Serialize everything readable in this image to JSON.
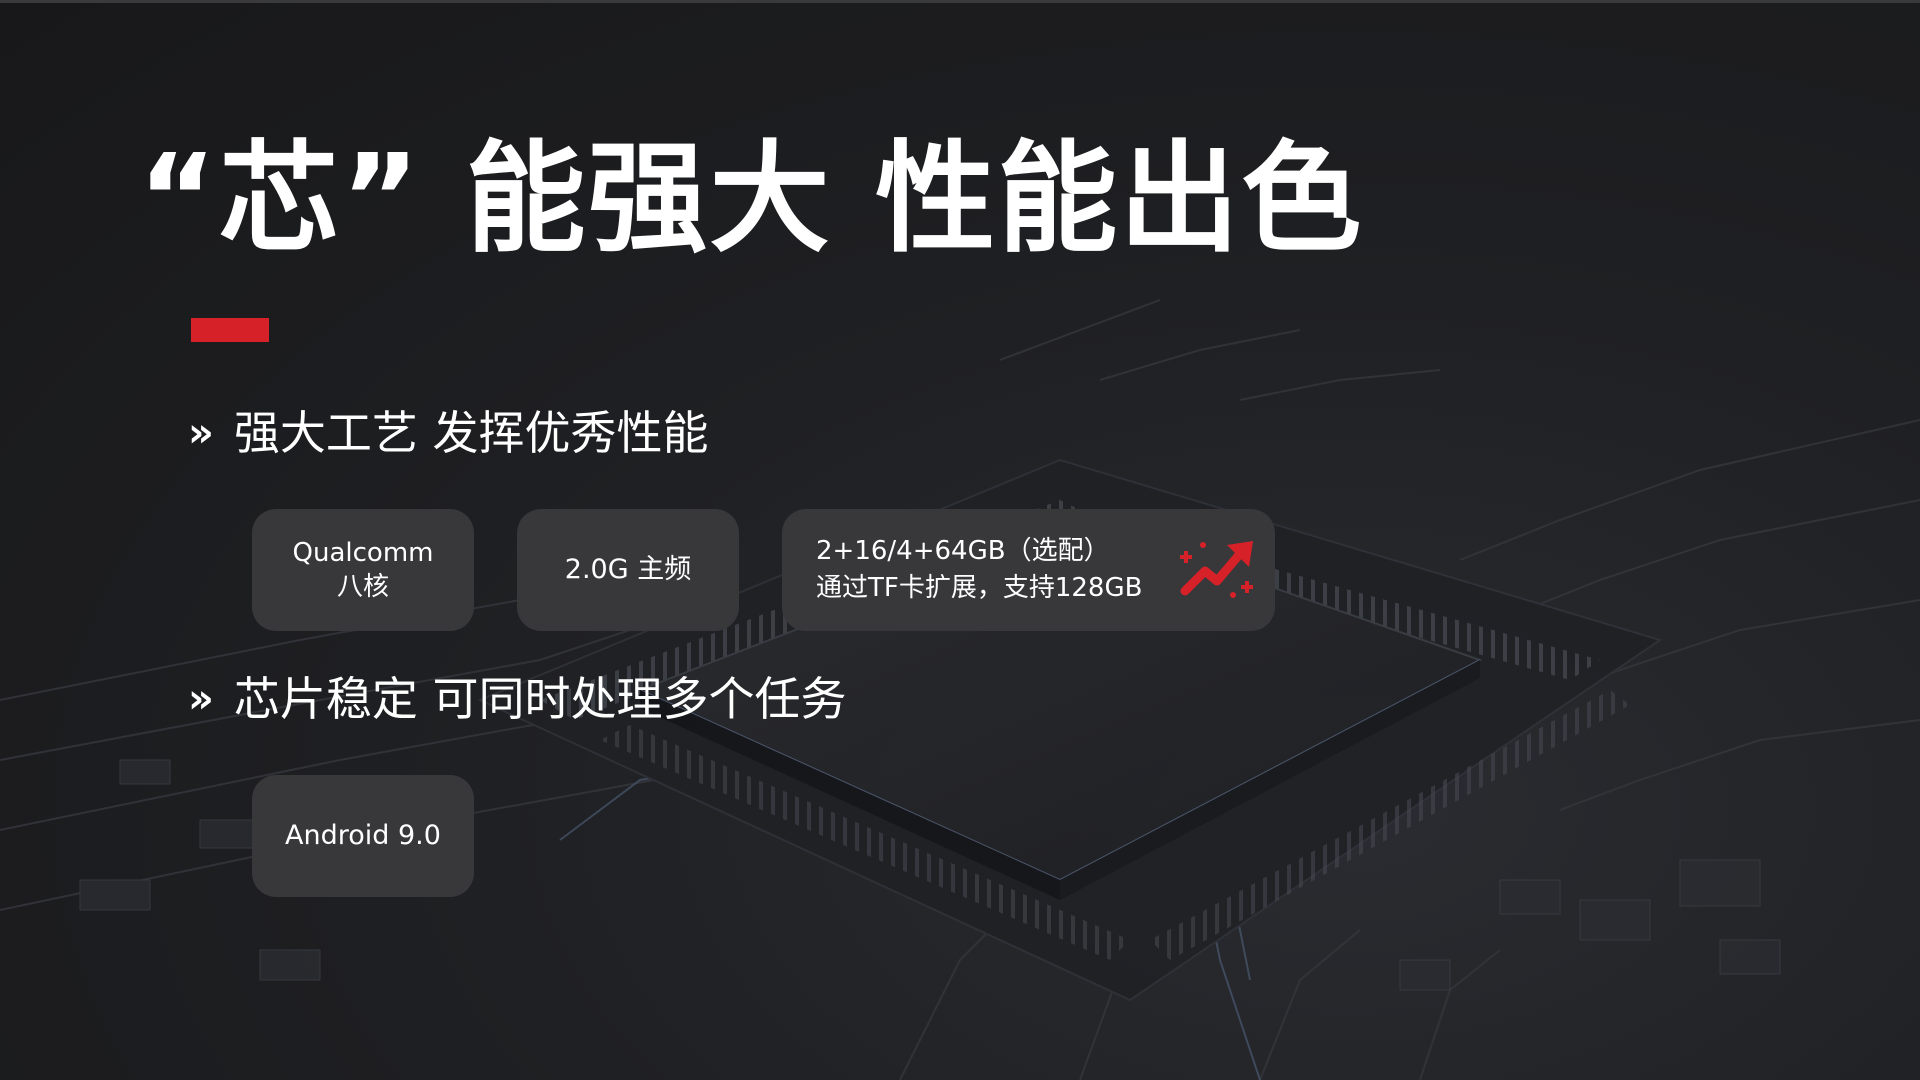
{
  "title": "“芯” 能强大 性能出色",
  "colors": {
    "accent": "#d62128",
    "card": "#38383b",
    "text": "#ffffff",
    "background": "#1b1b1d"
  },
  "sections": [
    {
      "marker": "»",
      "heading": "强大工艺  发挥优秀性能",
      "cards": [
        {
          "line1": "Qualcomm",
          "line2": "八核"
        },
        {
          "text": "2.0G 主频"
        },
        {
          "line1": "2+16/4+64GB（选配）",
          "line2": "通过TF卡扩展，支持128GB",
          "icon": "growth-chart-icon"
        }
      ]
    },
    {
      "marker": "»",
      "heading": "芯片稳定  可同时处理多个任务",
      "cards": [
        {
          "text": "Android 9.0"
        }
      ]
    }
  ]
}
